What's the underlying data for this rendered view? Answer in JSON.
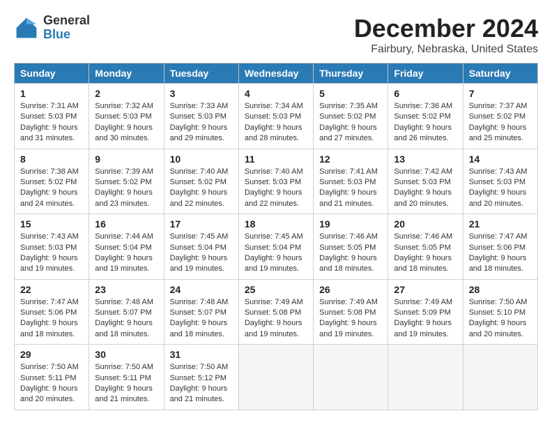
{
  "header": {
    "logo_general": "General",
    "logo_blue": "Blue",
    "month_title": "December 2024",
    "location": "Fairbury, Nebraska, United States"
  },
  "days_of_week": [
    "Sunday",
    "Monday",
    "Tuesday",
    "Wednesday",
    "Thursday",
    "Friday",
    "Saturday"
  ],
  "weeks": [
    [
      {
        "day": "1",
        "sunrise": "7:31 AM",
        "sunset": "5:03 PM",
        "daylight": "9 hours and 31 minutes."
      },
      {
        "day": "2",
        "sunrise": "7:32 AM",
        "sunset": "5:03 PM",
        "daylight": "9 hours and 30 minutes."
      },
      {
        "day": "3",
        "sunrise": "7:33 AM",
        "sunset": "5:03 PM",
        "daylight": "9 hours and 29 minutes."
      },
      {
        "day": "4",
        "sunrise": "7:34 AM",
        "sunset": "5:03 PM",
        "daylight": "9 hours and 28 minutes."
      },
      {
        "day": "5",
        "sunrise": "7:35 AM",
        "sunset": "5:02 PM",
        "daylight": "9 hours and 27 minutes."
      },
      {
        "day": "6",
        "sunrise": "7:36 AM",
        "sunset": "5:02 PM",
        "daylight": "9 hours and 26 minutes."
      },
      {
        "day": "7",
        "sunrise": "7:37 AM",
        "sunset": "5:02 PM",
        "daylight": "9 hours and 25 minutes."
      }
    ],
    [
      {
        "day": "8",
        "sunrise": "7:38 AM",
        "sunset": "5:02 PM",
        "daylight": "9 hours and 24 minutes."
      },
      {
        "day": "9",
        "sunrise": "7:39 AM",
        "sunset": "5:02 PM",
        "daylight": "9 hours and 23 minutes."
      },
      {
        "day": "10",
        "sunrise": "7:40 AM",
        "sunset": "5:02 PM",
        "daylight": "9 hours and 22 minutes."
      },
      {
        "day": "11",
        "sunrise": "7:40 AM",
        "sunset": "5:03 PM",
        "daylight": "9 hours and 22 minutes."
      },
      {
        "day": "12",
        "sunrise": "7:41 AM",
        "sunset": "5:03 PM",
        "daylight": "9 hours and 21 minutes."
      },
      {
        "day": "13",
        "sunrise": "7:42 AM",
        "sunset": "5:03 PM",
        "daylight": "9 hours and 20 minutes."
      },
      {
        "day": "14",
        "sunrise": "7:43 AM",
        "sunset": "5:03 PM",
        "daylight": "9 hours and 20 minutes."
      }
    ],
    [
      {
        "day": "15",
        "sunrise": "7:43 AM",
        "sunset": "5:03 PM",
        "daylight": "9 hours and 19 minutes."
      },
      {
        "day": "16",
        "sunrise": "7:44 AM",
        "sunset": "5:04 PM",
        "daylight": "9 hours and 19 minutes."
      },
      {
        "day": "17",
        "sunrise": "7:45 AM",
        "sunset": "5:04 PM",
        "daylight": "9 hours and 19 minutes."
      },
      {
        "day": "18",
        "sunrise": "7:45 AM",
        "sunset": "5:04 PM",
        "daylight": "9 hours and 19 minutes."
      },
      {
        "day": "19",
        "sunrise": "7:46 AM",
        "sunset": "5:05 PM",
        "daylight": "9 hours and 18 minutes."
      },
      {
        "day": "20",
        "sunrise": "7:46 AM",
        "sunset": "5:05 PM",
        "daylight": "9 hours and 18 minutes."
      },
      {
        "day": "21",
        "sunrise": "7:47 AM",
        "sunset": "5:06 PM",
        "daylight": "9 hours and 18 minutes."
      }
    ],
    [
      {
        "day": "22",
        "sunrise": "7:47 AM",
        "sunset": "5:06 PM",
        "daylight": "9 hours and 18 minutes."
      },
      {
        "day": "23",
        "sunrise": "7:48 AM",
        "sunset": "5:07 PM",
        "daylight": "9 hours and 18 minutes."
      },
      {
        "day": "24",
        "sunrise": "7:48 AM",
        "sunset": "5:07 PM",
        "daylight": "9 hours and 18 minutes."
      },
      {
        "day": "25",
        "sunrise": "7:49 AM",
        "sunset": "5:08 PM",
        "daylight": "9 hours and 19 minutes."
      },
      {
        "day": "26",
        "sunrise": "7:49 AM",
        "sunset": "5:08 PM",
        "daylight": "9 hours and 19 minutes."
      },
      {
        "day": "27",
        "sunrise": "7:49 AM",
        "sunset": "5:09 PM",
        "daylight": "9 hours and 19 minutes."
      },
      {
        "day": "28",
        "sunrise": "7:50 AM",
        "sunset": "5:10 PM",
        "daylight": "9 hours and 20 minutes."
      }
    ],
    [
      {
        "day": "29",
        "sunrise": "7:50 AM",
        "sunset": "5:11 PM",
        "daylight": "9 hours and 20 minutes."
      },
      {
        "day": "30",
        "sunrise": "7:50 AM",
        "sunset": "5:11 PM",
        "daylight": "9 hours and 21 minutes."
      },
      {
        "day": "31",
        "sunrise": "7:50 AM",
        "sunset": "5:12 PM",
        "daylight": "9 hours and 21 minutes."
      },
      null,
      null,
      null,
      null
    ]
  ]
}
